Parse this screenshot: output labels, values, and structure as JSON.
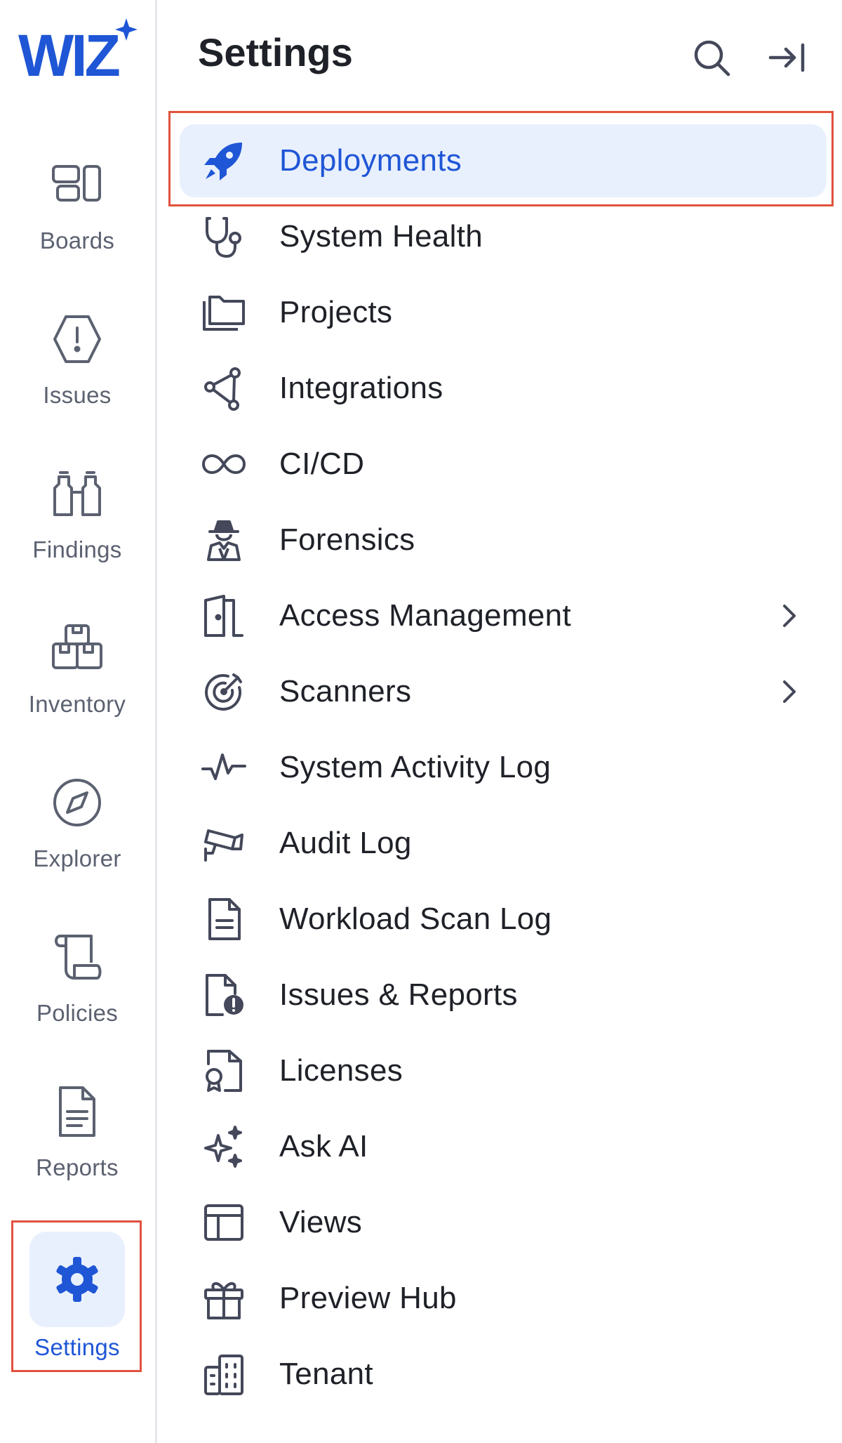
{
  "brand": {
    "name": "WIZ"
  },
  "colors": {
    "accent": "#1f56d6",
    "active_bg": "#e9f0fd",
    "highlight_box": "#e0523e",
    "icon": "#44485a"
  },
  "rail": {
    "items": [
      {
        "label": "Boards",
        "icon": "boards-icon"
      },
      {
        "label": "Issues",
        "icon": "issues-icon"
      },
      {
        "label": "Findings",
        "icon": "binoculars-icon"
      },
      {
        "label": "Inventory",
        "icon": "inventory-icon"
      },
      {
        "label": "Explorer",
        "icon": "compass-icon"
      },
      {
        "label": "Policies",
        "icon": "scroll-icon"
      },
      {
        "label": "Reports",
        "icon": "report-icon"
      },
      {
        "label": "Settings",
        "icon": "gear-icon",
        "active": true
      }
    ]
  },
  "panel": {
    "title": "Settings",
    "search_icon": "search-icon",
    "collapse_icon": "collapse-panel-icon",
    "items": [
      {
        "label": "Deployments",
        "icon": "rocket-icon",
        "selected": true
      },
      {
        "label": "System Health",
        "icon": "stethoscope-icon"
      },
      {
        "label": "Projects",
        "icon": "folders-icon"
      },
      {
        "label": "Integrations",
        "icon": "integrations-icon"
      },
      {
        "label": "CI/CD",
        "icon": "infinity-icon"
      },
      {
        "label": "Forensics",
        "icon": "detective-icon"
      },
      {
        "label": "Access Management",
        "icon": "door-icon",
        "has_submenu": true
      },
      {
        "label": "Scanners",
        "icon": "target-icon",
        "has_submenu": true
      },
      {
        "label": "System Activity Log",
        "icon": "activity-icon"
      },
      {
        "label": "Audit Log",
        "icon": "camera-icon"
      },
      {
        "label": "Workload Scan Log",
        "icon": "document-icon"
      },
      {
        "label": "Issues & Reports",
        "icon": "file-alert-icon"
      },
      {
        "label": "Licenses",
        "icon": "license-icon"
      },
      {
        "label": "Ask AI",
        "icon": "sparkles-icon"
      },
      {
        "label": "Views",
        "icon": "layout-icon"
      },
      {
        "label": "Preview Hub",
        "icon": "gift-icon"
      },
      {
        "label": "Tenant",
        "icon": "building-icon"
      }
    ]
  }
}
